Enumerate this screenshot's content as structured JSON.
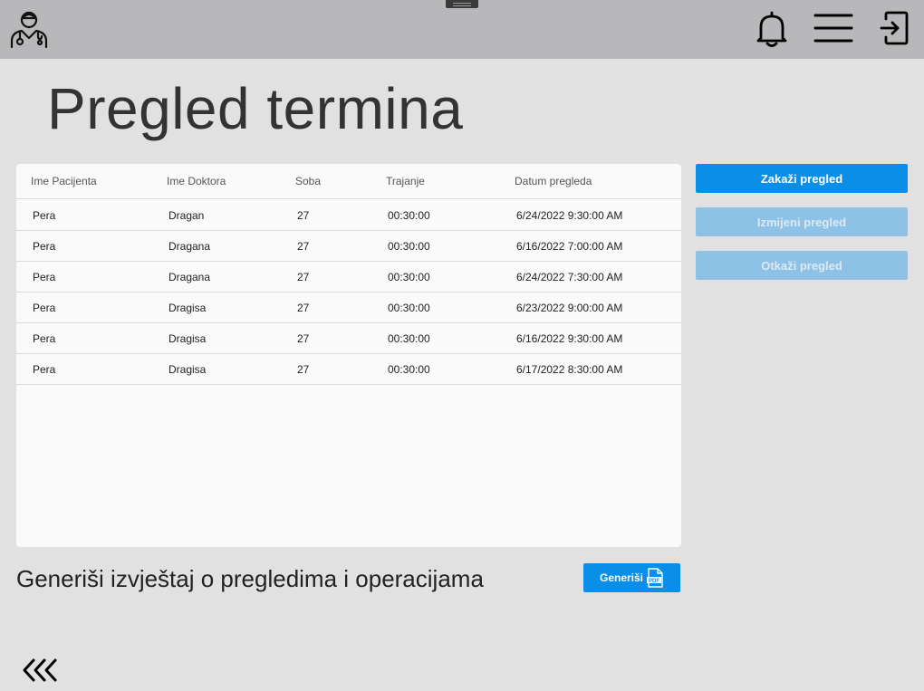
{
  "header": {
    "icons": [
      "doctor-avatar-icon",
      "bell-icon",
      "hamburger-menu-icon",
      "logout-icon"
    ]
  },
  "page": {
    "title": "Pregled termina"
  },
  "table": {
    "columns": [
      "Ime Pacijenta",
      "Ime Doktora",
      "Soba",
      "Trajanje",
      "Datum pregleda"
    ],
    "rows": [
      [
        "Pera",
        "Dragan",
        "27",
        "00:30:00",
        "6/24/2022 9:30:00 AM"
      ],
      [
        "Pera",
        "Dragana",
        "27",
        "00:30:00",
        "6/16/2022 7:00:00 AM"
      ],
      [
        "Pera",
        "Dragana",
        "27",
        "00:30:00",
        "6/24/2022 7:30:00 AM"
      ],
      [
        "Pera",
        "Dragisa",
        "27",
        "00:30:00",
        "6/23/2022 9:00:00 AM"
      ],
      [
        "Pera",
        "Dragisa",
        "27",
        "00:30:00",
        "6/16/2022 9:30:00 AM"
      ],
      [
        "Pera",
        "Dragisa",
        "27",
        "00:30:00",
        "6/17/2022 8:30:00 AM"
      ]
    ]
  },
  "actions": {
    "schedule": "Zakaži pregled",
    "edit": "Izmijeni pregled",
    "cancel": "Otkaži pregled"
  },
  "report": {
    "label": "Generiši izvještaj o pregledima i operacijama",
    "button": "Generiši",
    "button_icon": "pdf-file-icon"
  },
  "nav": {
    "back_icon": "triple-chevron-left-icon"
  },
  "colors": {
    "accent": "#0a8fe8",
    "accent_disabled": "#8dc2e6",
    "topbar": "#b8b8ba",
    "background": "#e1e1e1",
    "table_bg": "#fafafa"
  }
}
